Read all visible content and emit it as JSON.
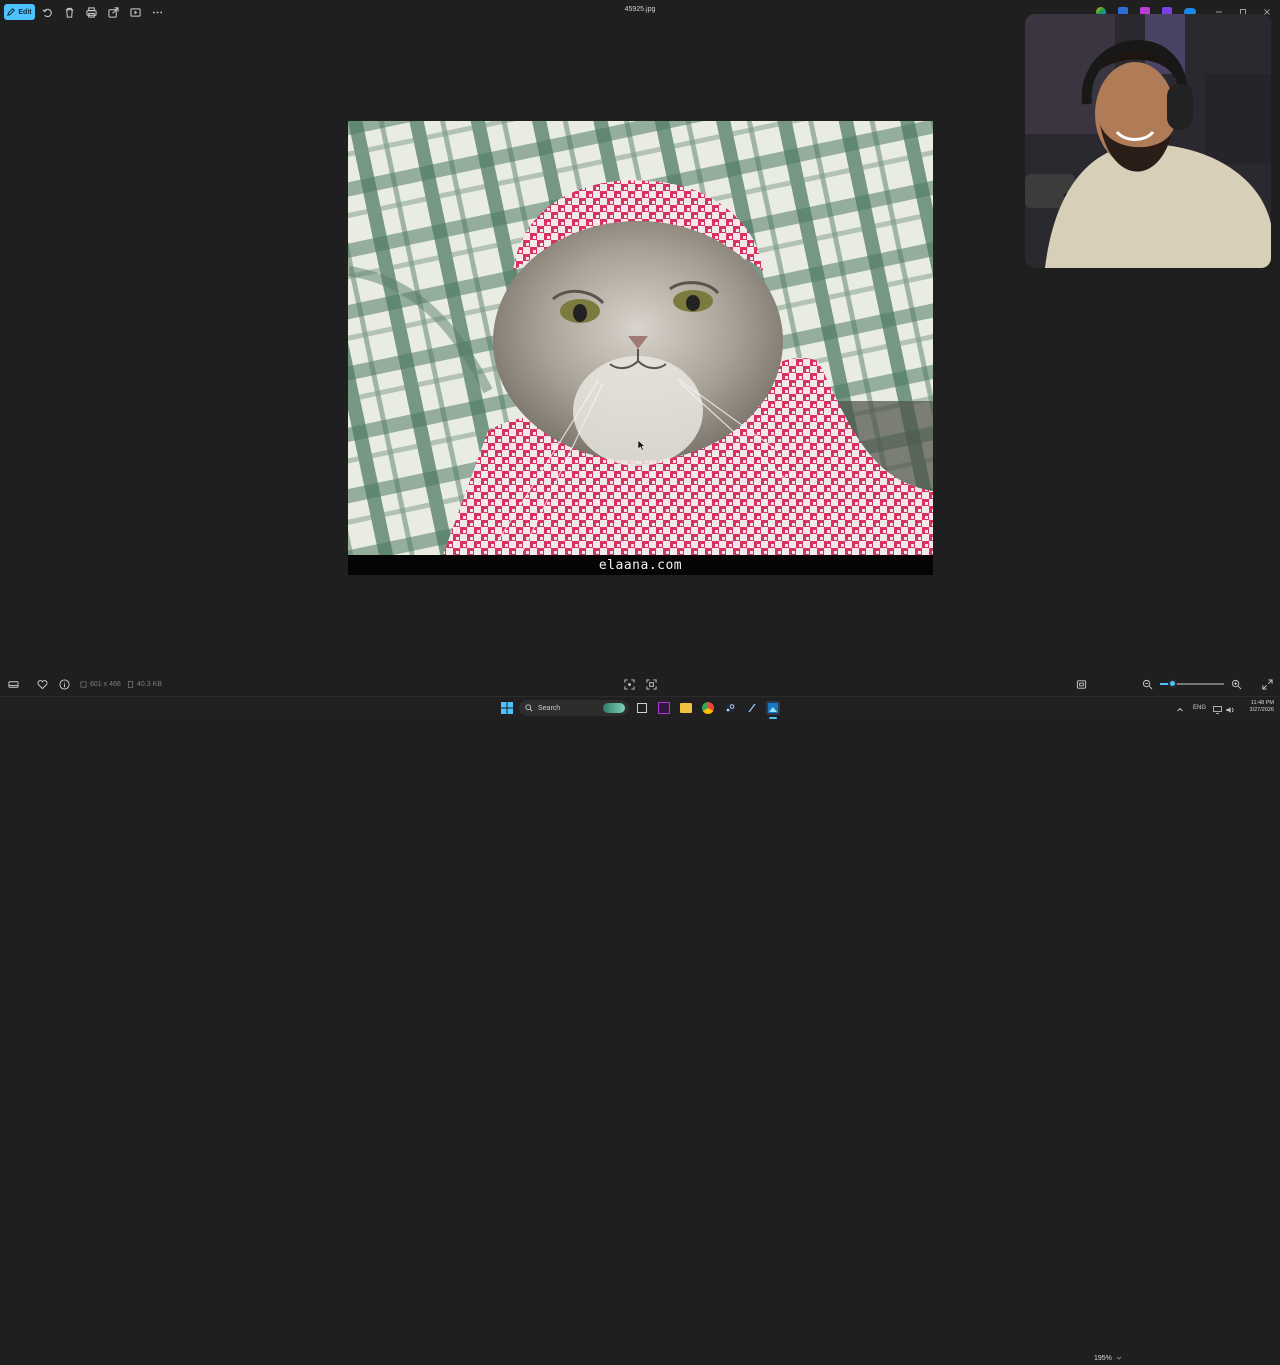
{
  "toolbar": {
    "edit_label": "Edit",
    "icons": [
      "rotate-icon",
      "delete-icon",
      "print-icon",
      "share-icon",
      "slideshow-icon",
      "more-icon"
    ]
  },
  "window": {
    "title": "45925.jpg"
  },
  "image": {
    "caption": "elaana.com"
  },
  "status": {
    "dimensions": "601 x 466",
    "file_size": "40.3 KB",
    "zoom": "195%",
    "zoom_fraction": 0.2
  },
  "taskbar": {
    "search_placeholder": "Search",
    "language": "ENG",
    "time": "11:48 PM",
    "date": "3/27/2026"
  },
  "colors": {
    "accent": "#4cc2ff",
    "background": "#1f1f1f",
    "taskbar": "#202020"
  }
}
